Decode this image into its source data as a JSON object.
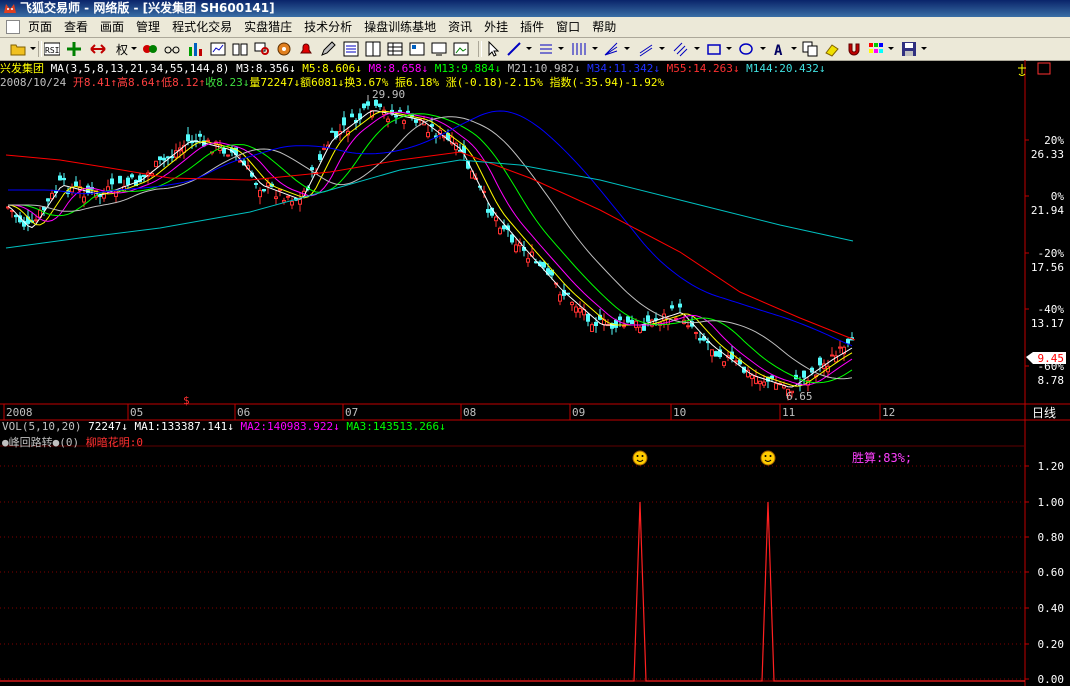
{
  "window": {
    "title": "飞狐交易师 - 网络版 - [兴发集团 SH600141]"
  },
  "menu": [
    "页面",
    "查看",
    "画面",
    "管理",
    "程式化交易",
    "实盘猎庄",
    "技术分析",
    "操盘训练基地",
    "资讯",
    "外挂",
    "插件",
    "窗口",
    "帮助"
  ],
  "toolbar": {
    "fq_label": "权"
  },
  "price": {
    "name": "兴发集团",
    "ma_params": "MA(3,5,8,13,21,34,55,144,8)",
    "ma3": "M3:8.356↓",
    "ma5": "M5:8.606↓",
    "ma8": "M8:8.658↓",
    "ma13": "M13:9.884↓",
    "ma21": "M21:10.982↓",
    "ma34": "M34:11.342↓",
    "ma55": "M55:14.263↓",
    "ma144": "M144:20.432↓",
    "date": "2008/10/24",
    "open": "开8.41↑",
    "high": "高8.64↑",
    "low": "低8.12↑",
    "close": "收8.23↓",
    "vol": "量72247↓",
    "amount": "额6081↓",
    "turnover": "换3.67%",
    "amplitude": "振6.18%",
    "change": "涨(-0.18)-2.15%",
    "index": "指数(-35.94)-1.92%",
    "hi_label": "29.90",
    "lo_label": "6.65",
    "last_price": "9.45",
    "s_marker": "$"
  },
  "price_axis": [
    {
      "t": "20%",
      "c": "#ffffff"
    },
    {
      "t": "26.33",
      "c": "#ffffff"
    },
    {
      "t": "0%",
      "c": "#ffffff"
    },
    {
      "t": "21.94",
      "c": "#ffffff"
    },
    {
      "t": "-20%",
      "c": "#ffffff"
    },
    {
      "t": "17.56",
      "c": "#ffffff"
    },
    {
      "t": "-40%",
      "c": "#ffffff"
    },
    {
      "t": "13.17",
      "c": "#ffffff"
    },
    {
      "t": "-60%",
      "c": "#ffffff"
    },
    {
      "t": "8.78",
      "c": "#ffffff"
    }
  ],
  "time_axis": [
    "2008",
    "05",
    "06",
    "07",
    "08",
    "09",
    "10",
    "11",
    "12"
  ],
  "period_label": "日线",
  "volume_line": {
    "vol": "VOL(5,10,20)",
    "val": "72247↓",
    "ma1": "MA1:133387.141↓",
    "ma2": "MA2:140983.922↓",
    "ma3": "MA3:143513.266↓"
  },
  "indicator": {
    "name": "峰回路转",
    "param": "(0)",
    "name2": "柳暗花明:0",
    "win_rate": "胜算:83%;",
    "axis": [
      "1.20",
      "1.00",
      "0.80",
      "0.60",
      "0.40",
      "0.20",
      "0.00"
    ]
  },
  "colors": {
    "up": "#ff3232",
    "down": "#54fcfc",
    "ma3": "#ffffff",
    "ma5": "#ffff00",
    "ma8": "#ff00ff",
    "ma13": "#00ff00",
    "ma21": "#c0c0c0",
    "ma34": "#0000ff",
    "ma55": "#ff0000",
    "ma144": "#00c0c0"
  },
  "chart_data": {
    "type": "candlestick",
    "symbol": "兴发集团 SH600141",
    "price_range": [
      6.65,
      29.9
    ],
    "last_close": 9.45,
    "x": [
      "2008",
      "05",
      "06",
      "07",
      "08",
      "09",
      "10",
      "11",
      "12"
    ],
    "series": [
      {
        "name": "峰回路转",
        "values": [
          0,
          0,
          0,
          0,
          0,
          0,
          0,
          0,
          0,
          1,
          0,
          0,
          0,
          1,
          0,
          0,
          0
        ]
      }
    ]
  }
}
